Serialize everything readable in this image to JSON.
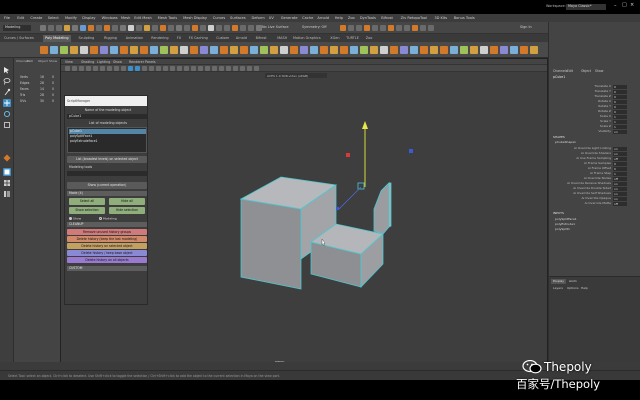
{
  "menubar": {
    "items": [
      "File",
      "Edit",
      "Create",
      "Select",
      "Modify",
      "Display",
      "Windows",
      "Mesh",
      "Edit Mesh",
      "Mesh Tools",
      "Mesh Display",
      "Curves",
      "Surfaces",
      "Deform",
      "UV",
      "Generate",
      "Cache",
      "Arnold",
      "Help",
      "Zoo",
      "DynTools",
      "Bifrost",
      "Ziv RetopoTool",
      "3D Kits",
      "Bonus Tools"
    ],
    "workspace_label": "Workspace:",
    "workspace_value": "Maya Classic*"
  },
  "statusline": {
    "mode": "Modeling",
    "live_surface": "No Live Surface",
    "symmetry": "Symmetry: Off",
    "sign_in": "Sign In"
  },
  "shelf_tabs": [
    "Curves / Surfaces",
    "Poly Modeling",
    "Sculpting",
    "Rigging",
    "Animation",
    "Rendering",
    "FX",
    "FX Caching",
    "Custom",
    "Arnold",
    "Bifrost",
    "MASH",
    "Motion Graphics",
    "XGen",
    "TURTLE",
    "Zoo"
  ],
  "active_shelf_tab": "Poly Modeling",
  "left_panel": {
    "menu": [
      "Channels",
      "Edit",
      "Object",
      "Show"
    ],
    "rows": [
      {
        "label": "Verts",
        "a": "16",
        "b": "0"
      },
      {
        "label": "Edges",
        "a": "28",
        "b": "0"
      },
      {
        "label": "Faces",
        "a": "14",
        "b": "0"
      },
      {
        "label": "Tris",
        "a": "28",
        "b": "0"
      },
      {
        "label": "UVs",
        "a": "30",
        "b": "0"
      }
    ]
  },
  "viewport": {
    "menu": [
      "View",
      "Shading",
      "Lighting",
      "Show",
      "Renderer",
      "Panels"
    ],
    "color_space": "ACES 1.0 SDR-video (sRGB)",
    "camera": "persp"
  },
  "script_window": {
    "title": "ScriptManager",
    "name_label": "Name of the modeling object",
    "name_value": "pCube1",
    "list_header": "List of modeling objects",
    "list_items": [
      "pCube1",
      "polySplitFace1",
      "polyExtrudeFace1"
    ],
    "list_selected_index": 0,
    "assign_button": "List (broadest levels) on selected object",
    "history_label": "Modeling tools",
    "history_value": "",
    "show_op_button": "Show (current operation)",
    "mode_section": "Mode (4)",
    "mode_buttons": [
      "Select all",
      "Hide all",
      "Show selection",
      "Hide selection"
    ],
    "radio_labels": [
      "Show",
      "Modeling"
    ],
    "cleanup_section": "CLEANUP",
    "color_buttons": [
      {
        "label": "Remove unused history groups",
        "color": "#d07a7a"
      },
      {
        "label": "Delete history (keep the last modeling)",
        "color": "#d08a6a"
      },
      {
        "label": "Delete history on selected object",
        "color": "#c4a060"
      },
      {
        "label": "Delete history / keep base object",
        "color": "#8a8ad4"
      },
      {
        "label": "Delete history on all objects",
        "color": "#9a7ad0"
      }
    ],
    "footer_section": "CUSTOM"
  },
  "channel_box": {
    "tabs": [
      "Channels",
      "Edit",
      "Object",
      "Show"
    ],
    "object_name": "pCube1",
    "attributes": [
      {
        "name": "Translate X",
        "value": "0"
      },
      {
        "name": "Translate Y",
        "value": "0"
      },
      {
        "name": "Translate Z",
        "value": "0"
      },
      {
        "name": "Rotate X",
        "value": "0"
      },
      {
        "name": "Rotate Y",
        "value": "0"
      },
      {
        "name": "Rotate Z",
        "value": "0"
      },
      {
        "name": "Scale X",
        "value": "1"
      },
      {
        "name": "Scale Y",
        "value": "1"
      },
      {
        "name": "Scale Z",
        "value": "1"
      },
      {
        "name": "Visibility",
        "value": "on"
      }
    ],
    "shapes_header": "SHAPES",
    "shape_name": "pCubeShape1",
    "shape_attrs": [
      {
        "name": "Ai Override Light Linking",
        "value": "on"
      },
      {
        "name": "Ai Override Shaders",
        "value": "on"
      },
      {
        "name": "Ai Use Frame Sampling",
        "value": "off"
      },
      {
        "name": "Ai Frame Samples",
        "value": "0"
      },
      {
        "name": "Ai Frame Offset",
        "value": "0"
      },
      {
        "name": "Ai Frame Step",
        "value": "1"
      },
      {
        "name": "Ai Override Nodes",
        "value": "off"
      },
      {
        "name": "Ai Override Receive Shadows",
        "value": "on"
      },
      {
        "name": "Ai Override Double Sided",
        "value": "on"
      },
      {
        "name": "Ai Override Self Shadows",
        "value": "on"
      },
      {
        "name": "Ai Override Opaque",
        "value": "on"
      },
      {
        "name": "Ai Override Matte",
        "value": "off"
      }
    ],
    "inputs_header": "INPUTS",
    "inputs": [
      "polySplitFace1",
      "polyExtrude1",
      "polySplit1"
    ]
  },
  "layer_editor": {
    "tabs": [
      "Display",
      "Anim"
    ],
    "menu": [
      "Layers",
      "Options",
      "Help"
    ]
  },
  "helpline": "Select Tool: select an object. Ctrl+click to deselect. Use Shift+click to toggle the selection / Ctrl+Shift+click to add the object to the current selection in Maya on the view port.",
  "watermark": {
    "brand": "Thepoly",
    "site": "百家号/Thepoly"
  },
  "colors": {
    "app_bg": "#444444",
    "viewport_bg": "#3e3e3e",
    "accent_cyan": "#19b3c9",
    "wireframe": "#4cc8d0",
    "shelf_highlight": "#d27a2a"
  }
}
